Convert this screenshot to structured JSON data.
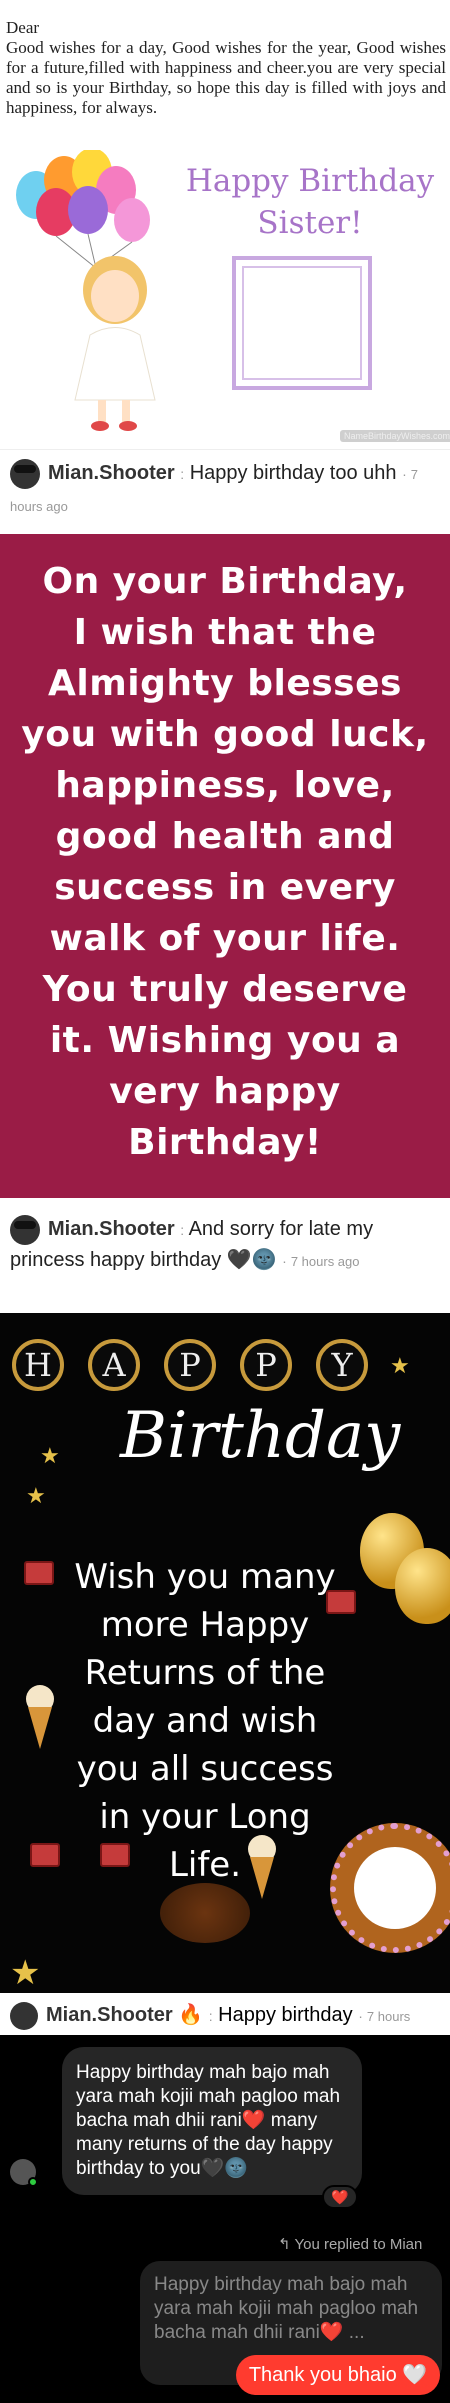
{
  "card1": {
    "greeting": "Dear",
    "message": "Good wishes for a day, Good wishes for the year, Good wishes for a future,filled with happiness and cheer.you are very special and so is your Birthday, so hope this day is filled with joys and happiness, for always.",
    "title_line1": "Happy Birthday",
    "title_line2": "Sister!",
    "watermark": "NameBirthdayWishes.com"
  },
  "comment1": {
    "author": "Mian.Shooter",
    "separator": ":",
    "text": "Happy birthday too uhh",
    "time": "7 hours ago"
  },
  "card2": {
    "lines": [
      "On your Birthday,",
      "I wish that the",
      "Almighty blesses",
      "you with good luck,",
      "happiness, love,",
      "good health and",
      "success in every",
      "walk of your life.",
      "You truly deserve",
      "it. Wishing you a",
      "very happy",
      "Birthday!"
    ]
  },
  "comment2": {
    "author": "Mian.Shooter",
    "separator": ":",
    "text": "And sorry for late my princess happy birthday 🖤🌚",
    "time": "7 hours ago"
  },
  "card3": {
    "letters": [
      "H",
      "A",
      "P",
      "P",
      "Y"
    ],
    "title": "Birthday",
    "wish_lines": [
      "Wish you many",
      "more Happy",
      "Returns of the",
      "day and wish",
      "you all success",
      "in your Long",
      "Life."
    ]
  },
  "comment3": {
    "author": "Mian.Shooter",
    "flame": "🔥",
    "separator": ":",
    "text": "Happy birthday",
    "time": "7 hours"
  },
  "dm": {
    "incoming": "Happy birthday mah bajo mah yara mah kojii mah pagloo mah bacha mah dhii rani❤️ many many returns of the day happy birthday to you🖤🌚",
    "reaction": "❤️",
    "replied_label": "You replied to Mian",
    "replied_text": "Happy birthday mah bajo mah yara mah kojii mah pagloo mah bacha mah dhii rani❤️ ...",
    "outgoing": "Thank you bhaio 🤍"
  },
  "colors": {
    "card2_bg": "#9a1c46",
    "card3_bg": "#050505",
    "title_purple": "#a774c8",
    "out_bubble": "#ff3b2f"
  }
}
